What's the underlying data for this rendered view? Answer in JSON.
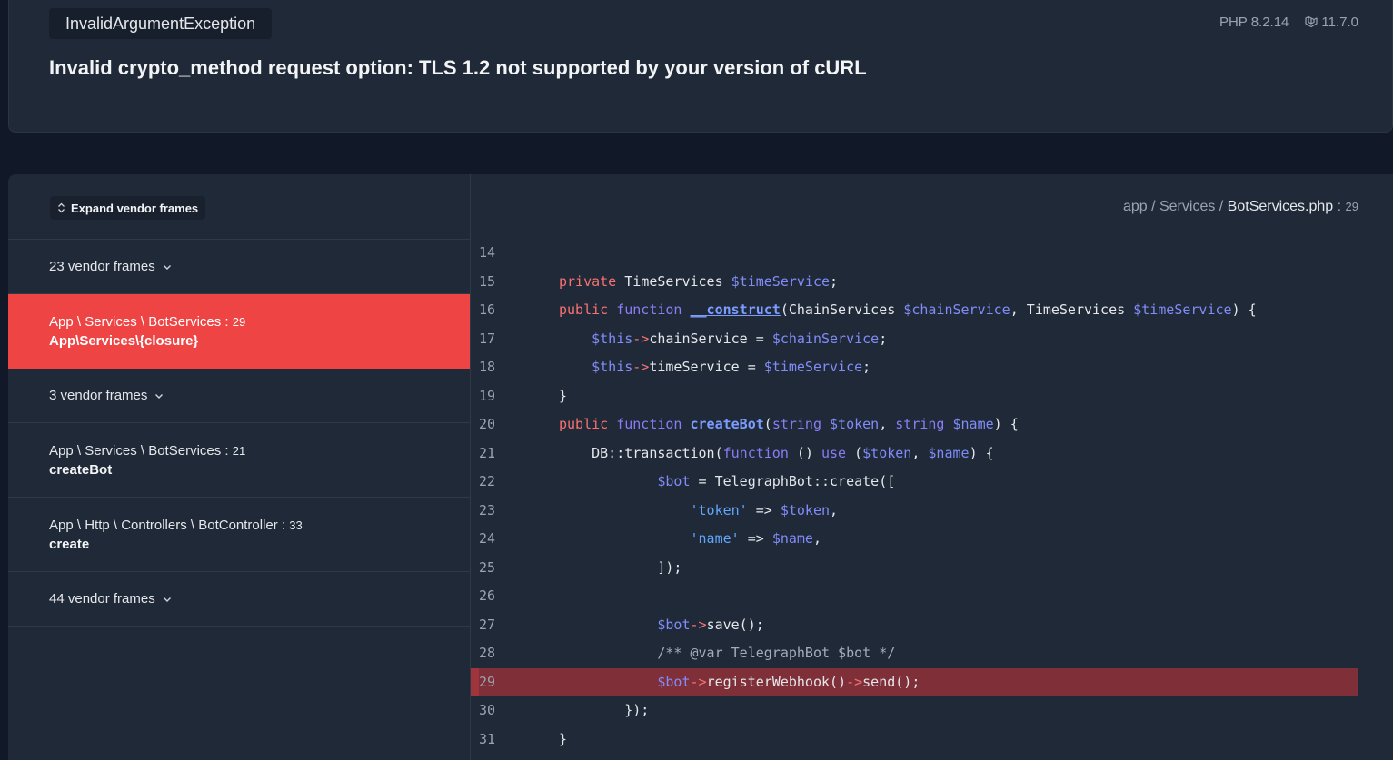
{
  "header": {
    "exception_class": "InvalidArgumentException",
    "message": "Invalid crypto_method request option: TLS 1.2 not supported by your version of cURL",
    "php_version": "PHP 8.2.14",
    "laravel_version": "11.7.0",
    "laravel_icon": "laravel-logo-icon"
  },
  "sidebar": {
    "expand_label": "Expand vendor frames",
    "expand_icon": "up-down-chevron-icon",
    "vendor1": "23 vendor frames",
    "active": {
      "class": "App \\ Services \\ BotServices",
      "line": "29",
      "function": "App\\Services\\{closure}"
    },
    "vendor2": "3 vendor frames",
    "frame2": {
      "class": "App \\ Services \\ BotServices",
      "line": "21",
      "function": "createBot"
    },
    "frame3": {
      "class": "App \\ Http \\ Controllers \\ BotController",
      "line": "33",
      "function": "create"
    },
    "vendor3": "44 vendor frames"
  },
  "code": {
    "path_prefix": "app / Services / ",
    "file_name": "BotServices.php",
    "line_sep": " : ",
    "line_number": "29",
    "highlight_line": 29,
    "lines": [
      {
        "n": "14",
        "t": ""
      },
      {
        "n": "15",
        "t": "    private TimeServices $timeService;"
      },
      {
        "n": "16",
        "t": "    public function __construct(ChainServices $chainService, TimeServices $timeService) {"
      },
      {
        "n": "17",
        "t": "        $this->chainService = $chainService;"
      },
      {
        "n": "18",
        "t": "        $this->timeService = $timeService;"
      },
      {
        "n": "19",
        "t": "    }"
      },
      {
        "n": "20",
        "t": "    public function createBot(string $token, string $name) {"
      },
      {
        "n": "21",
        "t": "        DB::transaction(function () use ($token, $name) {"
      },
      {
        "n": "22",
        "t": "                $bot = TelegraphBot::create(["
      },
      {
        "n": "23",
        "t": "                    'token' => $token,"
      },
      {
        "n": "24",
        "t": "                    'name' => $name,"
      },
      {
        "n": "25",
        "t": "                ]);"
      },
      {
        "n": "26",
        "t": ""
      },
      {
        "n": "27",
        "t": "                $bot->save();"
      },
      {
        "n": "28",
        "t": "                /** @var TelegraphBot $bot */"
      },
      {
        "n": "29",
        "t": "                $bot->registerWebhook()->send();"
      },
      {
        "n": "30",
        "t": "            });"
      },
      {
        "n": "31",
        "t": "    }"
      }
    ]
  }
}
